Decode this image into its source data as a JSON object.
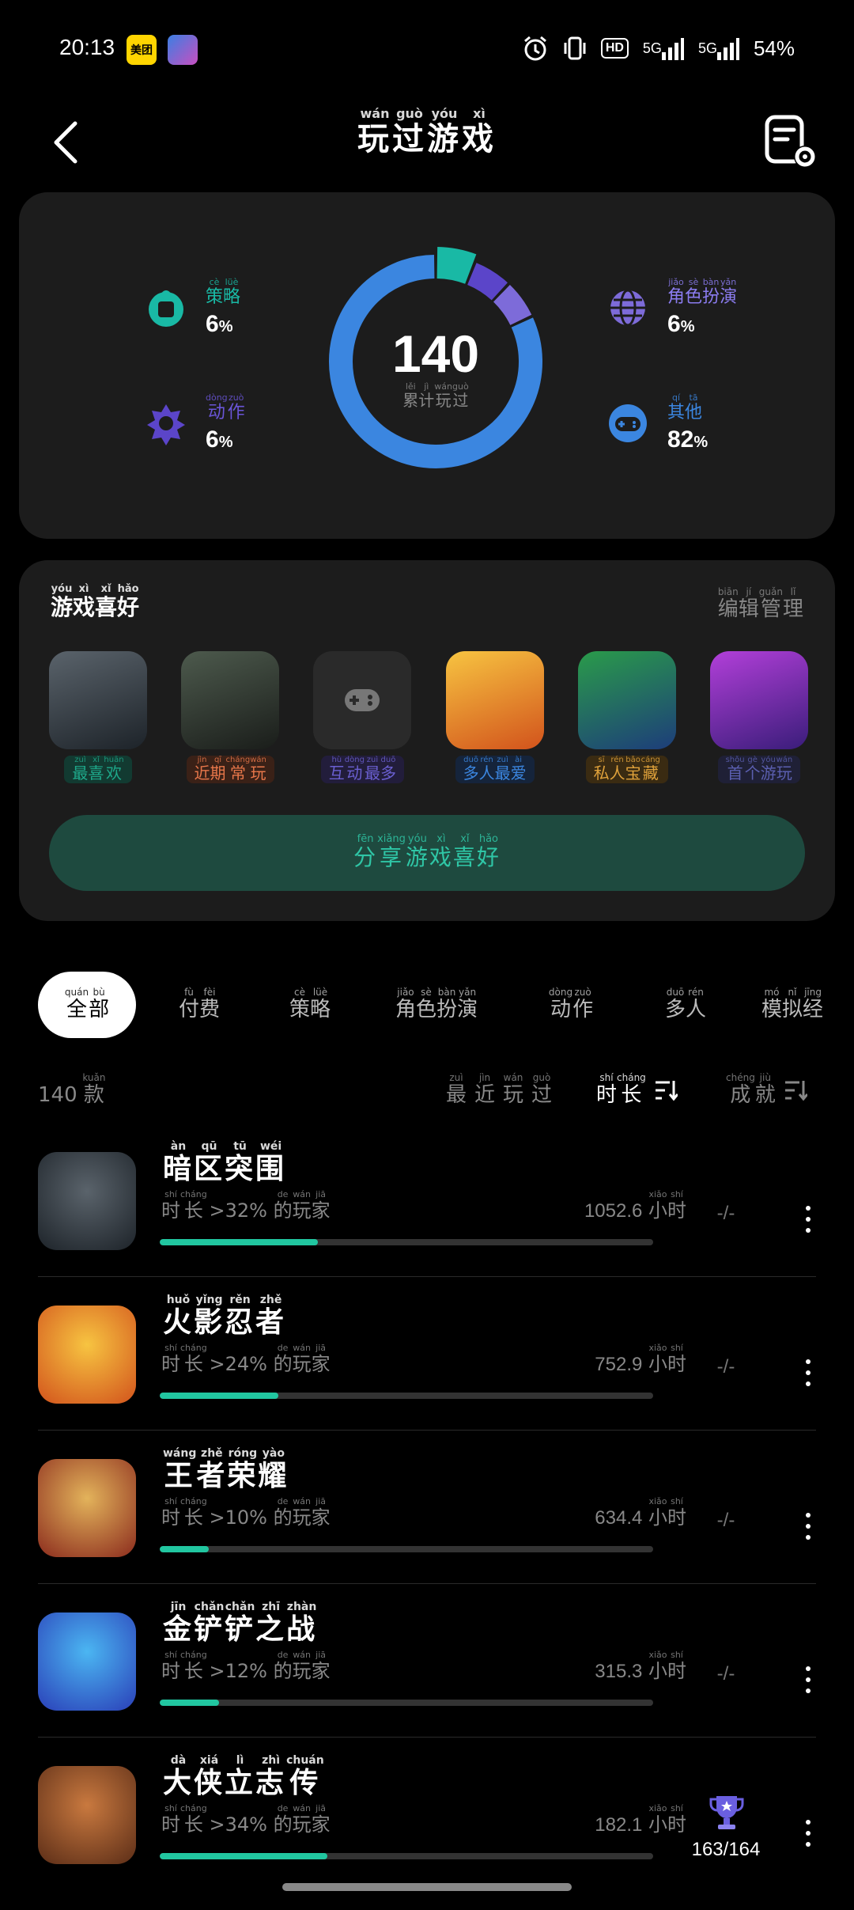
{
  "status_bar": {
    "time": "20:13",
    "app_badge": "美团",
    "network_5g_a": "5G",
    "network_5g_b": "5G",
    "battery": "54%",
    "hd": "HD"
  },
  "header": {
    "title_chars": [
      {
        "c": "玩",
        "p": "wán"
      },
      {
        "c": "过",
        "p": "guò"
      },
      {
        "c": "游",
        "p": "yóu"
      },
      {
        "c": "戏",
        "p": "xì"
      }
    ]
  },
  "stats": {
    "total": "140",
    "total_label": [
      {
        "c": "累",
        "p": "lěi"
      },
      {
        "c": "计",
        "p": "jì"
      },
      {
        "c": "玩",
        "p": "wán"
      },
      {
        "c": "过",
        "p": "guò"
      }
    ],
    "categories": [
      {
        "name": [
          {
            "c": "策",
            "p": "cè"
          },
          {
            "c": "略",
            "p": "lüè"
          }
        ],
        "pct": "6",
        "color": "#19b9a5"
      },
      {
        "name": [
          {
            "c": "动",
            "p": "dòng"
          },
          {
            "c": "作",
            "p": "zuò"
          }
        ],
        "pct": "6",
        "color": "#5b45c9"
      },
      {
        "name": [
          {
            "c": "角",
            "p": "jiǎo"
          },
          {
            "c": "色",
            "p": "sè"
          },
          {
            "c": "扮",
            "p": "bàn"
          },
          {
            "c": "演",
            "p": "yǎn"
          }
        ],
        "pct": "6",
        "color": "#7d6bd9"
      },
      {
        "name": [
          {
            "c": "其",
            "p": "qí"
          },
          {
            "c": "他",
            "p": "tā"
          }
        ],
        "pct": "82",
        "color": "#3b86e0"
      }
    ],
    "pct_unit": "%"
  },
  "preferences": {
    "title": [
      {
        "c": "游",
        "p": "yóu"
      },
      {
        "c": "戏",
        "p": "xì"
      },
      {
        "c": "喜",
        "p": "xǐ"
      },
      {
        "c": "好",
        "p": "hǎo"
      }
    ],
    "manage": [
      {
        "c": "编",
        "p": "biān"
      },
      {
        "c": "辑",
        "p": "jí"
      },
      {
        "c": "管",
        "p": "guǎn"
      },
      {
        "c": "理",
        "p": "lǐ"
      }
    ],
    "items": [
      {
        "label": [
          {
            "c": "最",
            "p": "zuì"
          },
          {
            "c": "喜",
            "p": "xǐ"
          },
          {
            "c": "欢",
            "p": "huān"
          }
        ],
        "color": "#1ea88a",
        "bg": "#123a31"
      },
      {
        "label": [
          {
            "c": "近",
            "p": "jìn"
          },
          {
            "c": "期",
            "p": "qī"
          },
          {
            "c": "常",
            "p": "cháng"
          },
          {
            "c": "玩",
            "p": "wán"
          }
        ],
        "color": "#e8774a",
        "bg": "#3a2117"
      },
      {
        "label": [
          {
            "c": "互",
            "p": "hù"
          },
          {
            "c": "动",
            "p": "dòng"
          },
          {
            "c": "最",
            "p": "zuì"
          },
          {
            "c": "多",
            "p": "duō"
          }
        ],
        "color": "#6a5fd0",
        "bg": "#221d3b"
      },
      {
        "label": [
          {
            "c": "多",
            "p": "duō"
          },
          {
            "c": "人",
            "p": "rén"
          },
          {
            "c": "最",
            "p": "zuì"
          },
          {
            "c": "爱",
            "p": "ài"
          }
        ],
        "color": "#3b86e0",
        "bg": "#15243b"
      },
      {
        "label": [
          {
            "c": "私",
            "p": "sī"
          },
          {
            "c": "人",
            "p": "rén"
          },
          {
            "c": "宝",
            "p": "bǎo"
          },
          {
            "c": "藏",
            "p": "cáng"
          }
        ],
        "color": "#e0a23b",
        "bg": "#3a2b12"
      },
      {
        "label": [
          {
            "c": "首",
            "p": "shǒu"
          },
          {
            "c": "个",
            "p": "gè"
          },
          {
            "c": "游",
            "p": "yóu"
          },
          {
            "c": "玩",
            "p": "wán"
          }
        ],
        "color": "#5b5fb0",
        "bg": "#1f2036"
      }
    ],
    "share": [
      {
        "c": "分",
        "p": "fēn"
      },
      {
        "c": "享",
        "p": "xiǎng"
      },
      {
        "c": "游",
        "p": "yóu"
      },
      {
        "c": "戏",
        "p": "xì"
      },
      {
        "c": "喜",
        "p": "xǐ"
      },
      {
        "c": "好",
        "p": "hǎo"
      }
    ]
  },
  "tabs": [
    [
      {
        "c": "全",
        "p": "quán"
      },
      {
        "c": "部",
        "p": "bù"
      }
    ],
    [
      {
        "c": "付",
        "p": "fù"
      },
      {
        "c": "费",
        "p": "fèi"
      }
    ],
    [
      {
        "c": "策",
        "p": "cè"
      },
      {
        "c": "略",
        "p": "lüè"
      }
    ],
    [
      {
        "c": "角",
        "p": "jiǎo"
      },
      {
        "c": "色",
        "p": "sè"
      },
      {
        "c": "扮",
        "p": "bàn"
      },
      {
        "c": "演",
        "p": "yǎn"
      }
    ],
    [
      {
        "c": "动",
        "p": "dòng"
      },
      {
        "c": "作",
        "p": "zuò"
      }
    ],
    [
      {
        "c": "多",
        "p": "duō"
      },
      {
        "c": "人",
        "p": "rén"
      }
    ],
    [
      {
        "c": "模",
        "p": "mó"
      },
      {
        "c": "拟",
        "p": "nǐ"
      },
      {
        "c": "经",
        "p": "jīng"
      }
    ]
  ],
  "sortbar": {
    "count_num": "140",
    "count_unit": [
      {
        "c": "款",
        "p": "kuǎn"
      }
    ],
    "recent": [
      {
        "c": "最",
        "p": "zuì"
      },
      {
        "c": "近",
        "p": "jìn"
      },
      {
        "c": "玩",
        "p": "wán"
      },
      {
        "c": "过",
        "p": "guò"
      }
    ],
    "duration": [
      {
        "c": "时",
        "p": "shí"
      },
      {
        "c": "长",
        "p": "cháng"
      }
    ],
    "achievement": [
      {
        "c": "成",
        "p": "chéng"
      },
      {
        "c": "就",
        "p": "jiù"
      }
    ]
  },
  "desc_prefix": [
    {
      "c": "时",
      "p": "shí"
    },
    {
      "c": "长",
      "p": "cháng"
    }
  ],
  "desc_suffix": [
    {
      "c": "的",
      "p": "de"
    },
    {
      "c": "玩",
      "p": "wán"
    },
    {
      "c": "家",
      "p": "jiā"
    }
  ],
  "hours_unit": [
    {
      "c": "小",
      "p": "xiǎo"
    },
    {
      "c": "时",
      "p": "shí"
    }
  ],
  "games": [
    {
      "name": [
        {
          "c": "暗",
          "p": "àn"
        },
        {
          "c": "区",
          "p": "qū"
        },
        {
          "c": "突",
          "p": "tū"
        },
        {
          "c": "围",
          "p": "wéi"
        }
      ],
      "pct": ">32%",
      "hours": "1052.6",
      "progress": 0.32,
      "ach": "-/-",
      "has_trophy": false,
      "colors": [
        "#5a636b",
        "#1d2329"
      ]
    },
    {
      "name": [
        {
          "c": "火",
          "p": "huǒ"
        },
        {
          "c": "影",
          "p": "yǐng"
        },
        {
          "c": "忍",
          "p": "rěn"
        },
        {
          "c": "者",
          "p": "zhě"
        }
      ],
      "pct": ">24%",
      "hours": "752.9",
      "progress": 0.24,
      "ach": "-/-",
      "has_trophy": false,
      "colors": [
        "#f7c441",
        "#d2531c"
      ]
    },
    {
      "name": [
        {
          "c": "王",
          "p": "wáng"
        },
        {
          "c": "者",
          "p": "zhě"
        },
        {
          "c": "荣",
          "p": "róng"
        },
        {
          "c": "耀",
          "p": "yào"
        }
      ],
      "pct": ">10%",
      "hours": "634.4",
      "progress": 0.1,
      "ach": "-/-",
      "has_trophy": false,
      "colors": [
        "#e3b35b",
        "#8b2b1d"
      ]
    },
    {
      "name": [
        {
          "c": "金",
          "p": "jīn"
        },
        {
          "c": "铲",
          "p": "chǎn"
        },
        {
          "c": "铲",
          "p": "chǎn"
        },
        {
          "c": "之",
          "p": "zhī"
        },
        {
          "c": "战",
          "p": "zhàn"
        }
      ],
      "pct": ">12%",
      "hours": "315.3",
      "progress": 0.12,
      "ach": "-/-",
      "has_trophy": false,
      "colors": [
        "#4bb6f2",
        "#2a3fb8"
      ]
    },
    {
      "name": [
        {
          "c": "大",
          "p": "dà"
        },
        {
          "c": "侠",
          "p": "xiá"
        },
        {
          "c": "立",
          "p": "lì"
        },
        {
          "c": "志",
          "p": "zhì"
        },
        {
          "c": "传",
          "p": "chuán"
        }
      ],
      "pct": ">34%",
      "hours": "182.1",
      "progress": 0.34,
      "ach": "163/164",
      "has_trophy": true,
      "colors": [
        "#c9793f",
        "#5b2d17"
      ]
    }
  ]
}
